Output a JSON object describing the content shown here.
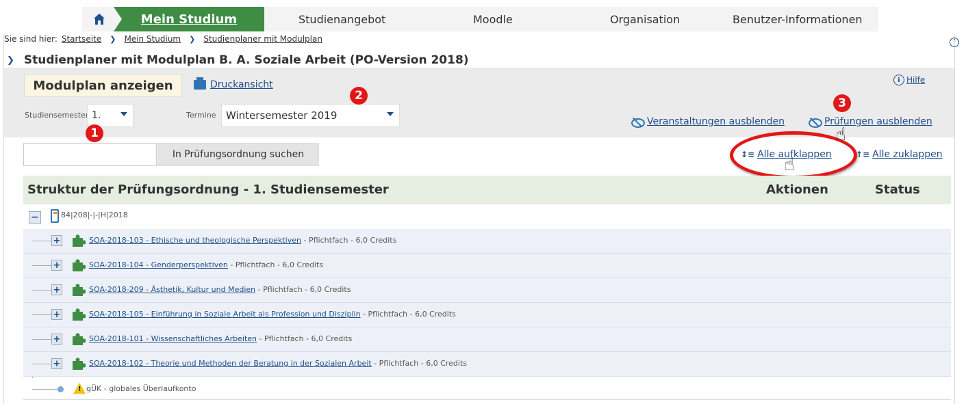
{
  "nav": {
    "home_icon": "home-icon",
    "items": [
      "Mein Studium",
      "Studienangebot",
      "Moodle",
      "Organisation",
      "Benutzer-Informationen"
    ],
    "active_color": "#3f8c44"
  },
  "breadcrumb": {
    "prefix": "Sie sind hier:",
    "items": [
      "Startseite",
      "Mein Studium",
      "Studienplaner mit Modulplan"
    ]
  },
  "page_title": "Studienplaner mit Modulplan B. A. Soziale Arbeit (PO-Version 2018)",
  "controls": {
    "modulplan_button": "Modulplan anzeigen",
    "print_link": "Druckansicht",
    "help_link": "Hilfe",
    "semester_label": "Studiensemester",
    "semester_value": "1.",
    "termin_label": "Termine",
    "termin_value": "Wintersemester 2019",
    "hide_events": "Veranstaltungen ausblenden",
    "hide_exams": "Prüfungen ausblenden"
  },
  "search": {
    "placeholder": "",
    "button": "In Prüfungsordnung suchen"
  },
  "expand": {
    "expand_all": "Alle aufklappen",
    "collapse_all": "Alle zuklappen"
  },
  "badges": [
    "1",
    "2",
    "3"
  ],
  "structure": {
    "title": "Struktur der Prüfungsordnung - 1. Studiensemester",
    "col_actions": "Aktionen",
    "col_status": "Status",
    "root": "84|208|-|-|H|2018",
    "modules": [
      {
        "link": "SOA-2018-103 - Ethische und theologische Perspektiven",
        "meta": " - Pflichtfach - 6,0 Credits"
      },
      {
        "link": "SOA-2018-104 - Genderperspektiven",
        "meta": " - Pflichtfach - 6,0 Credits"
      },
      {
        "link": "SOA-2018-209 - Ästhetik, Kultur und Medien",
        "meta": " - Pflichtfach - 6,0 Credits"
      },
      {
        "link": "SOA-2018-105 - Einführung in Soziale Arbeit als Profession und Disziplin",
        "meta": " - Pflichtfach - 6,0 Credits"
      },
      {
        "link": "SOA-2018-101 - Wissenschaftliches Arbeiten",
        "meta": " - Pflichtfach - 6,0 Credits"
      },
      {
        "link": "SOA-2018-102 - Theorie und Methoden der Beratung in der Sozialen Arbeit",
        "meta": " - Pflichtfach - 6,0 Credits"
      }
    ],
    "overflow": "gÜK - globales Überlaufkonto"
  }
}
